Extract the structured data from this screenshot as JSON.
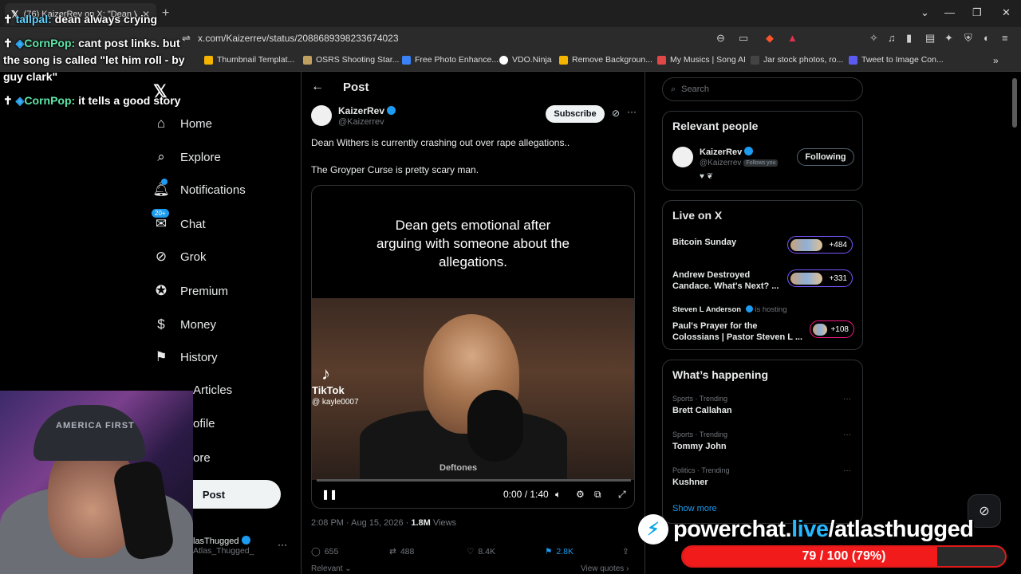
{
  "browser": {
    "tab_title": "(76) KaizerRev on X: \"Dean W",
    "url": "x.com/Kaizerrev/status/2088689398233674023",
    "bookmarks": [
      {
        "label": "Thumbnail Templat...",
        "color": "#f4b400"
      },
      {
        "label": "OSRS Shooting Star...",
        "color": "#c0a060"
      },
      {
        "label": "Free Photo Enhance...",
        "color": "#3b82f6"
      },
      {
        "label": "VDO.Ninja",
        "color": "#ffffff"
      },
      {
        "label": "Remove Backgroun...",
        "color": "#f4b400"
      },
      {
        "label": "My Musics | Song AI",
        "color": "#e04848"
      },
      {
        "label": "Jar stock photos, ro...",
        "color": "#222222"
      },
      {
        "label": "Tweet to Image Con...",
        "color": "#5b5bf0"
      }
    ]
  },
  "nav": {
    "items": [
      {
        "label": "Home",
        "icon": "home-icon"
      },
      {
        "label": "Explore",
        "icon": "search-icon"
      },
      {
        "label": "Notifications",
        "icon": "bell-icon"
      },
      {
        "label": "Chat",
        "icon": "chat-icon",
        "badge": "20+"
      },
      {
        "label": "Grok",
        "icon": "grok-icon"
      },
      {
        "label": "Premium",
        "icon": "premium-icon"
      },
      {
        "label": "Money",
        "icon": "money-icon"
      },
      {
        "label": "History",
        "icon": "bookmark-icon"
      }
    ],
    "partial_items": [
      "Articles",
      "ofile",
      "ore"
    ],
    "post_button": "Post",
    "account_name": "lasThugged",
    "account_handle": "Atlas_Thugged_"
  },
  "post": {
    "header": "Post",
    "author_name": "KaizerRev",
    "author_handle": "@Kaizerrev",
    "subscribe": "Subscribe",
    "text_line1": "Dean Withers is currently crashing out over rape allegations..",
    "text_line2": "The Groyper Curse is pretty scary man.",
    "video_caption": "Dean gets emotional after arguing with someone about the allegations.",
    "tiktok_label": "TikTok",
    "tiktok_handle": "@ kayle0007",
    "shirt_text": "Deftones",
    "time_display": "0:00 / 1:40",
    "progress": 0,
    "timestamp": "2:08 PM · Aug 15, 2026 ·",
    "views_count": "1.8M",
    "views_label": "Views",
    "replies": "655",
    "reposts": "488",
    "likes": "8.4K",
    "bookmarks": "2.8K",
    "relevant": "Relevant",
    "view_quotes": "View quotes"
  },
  "right": {
    "search_placeholder": "Search",
    "relevant_title": "Relevant people",
    "rp_name": "KaizerRev",
    "rp_handle": "@Kaizerrev",
    "rp_follows": "Follows you",
    "rp_following": "Following",
    "live_title": "Live on X",
    "live": [
      {
        "title": "Bitcoin Sunday",
        "count": "+484"
      },
      {
        "title": "Andrew Destroyed Candace. What's Next? ...",
        "count": "+331"
      },
      {
        "title": "Paul's Prayer for the Colossians | Pastor Steven L ...",
        "count": "+108"
      }
    ],
    "host_name": "Steven L Anderson",
    "host_suffix": "is hosting",
    "trending_title": "What’s happening",
    "trends": [
      {
        "meta": "Sports · Trending",
        "name": "Brett Callahan"
      },
      {
        "meta": "Sports · Trending",
        "name": "Tommy John"
      },
      {
        "meta": "Politics · Trending",
        "name": "Kushner"
      }
    ],
    "show_more": "Show more"
  },
  "overlay": {
    "chat": [
      {
        "user": "tallpal",
        "text": "dean always crying",
        "color": "cyan"
      },
      {
        "user": "CornPop",
        "text": "cant post links. but the song is called \"let him roll - by guy clark\"",
        "color": "green"
      },
      {
        "user": "CornPop",
        "text": "it tells a good story",
        "color": "green"
      }
    ],
    "cap_text": "AMERICA FIRST",
    "powerchat_main": "powerchat.",
    "powerchat_live": "live",
    "powerchat_path": "/atlasthugged",
    "goal_text": "79 / 100 (79%)",
    "goal_fraction": 0.79
  }
}
